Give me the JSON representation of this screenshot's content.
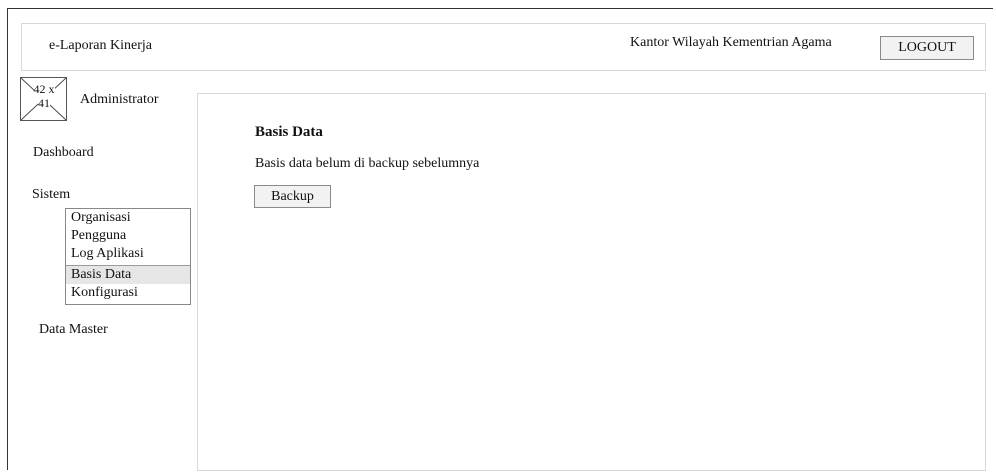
{
  "header": {
    "app_title": "e-Laporan Kinerja",
    "office_name": "Kantor Wilayah Kementrian Agama",
    "logout_label": "LOGOUT"
  },
  "user": {
    "avatar_placeholder_line1": "42 x",
    "avatar_placeholder_line2": "41",
    "role": "Administrator"
  },
  "sidebar": {
    "dashboard_label": "Dashboard",
    "sistem_label": "Sistem",
    "sistem_items": [
      {
        "label": "Organisasi"
      },
      {
        "label": "Pengguna"
      },
      {
        "label": "Log Aplikasi"
      },
      {
        "label": "Basis Data",
        "active": true
      },
      {
        "label": "Konfigurasi"
      }
    ],
    "data_master_label": "Data Master"
  },
  "main": {
    "title": "Basis Data",
    "description": "Basis data belum di backup sebelumnya",
    "backup_label": "Backup"
  },
  "colors": {
    "border": "#d8d8d8",
    "button_bg": "#f2f2f2",
    "active_item_bg": "#e6e6e6"
  }
}
